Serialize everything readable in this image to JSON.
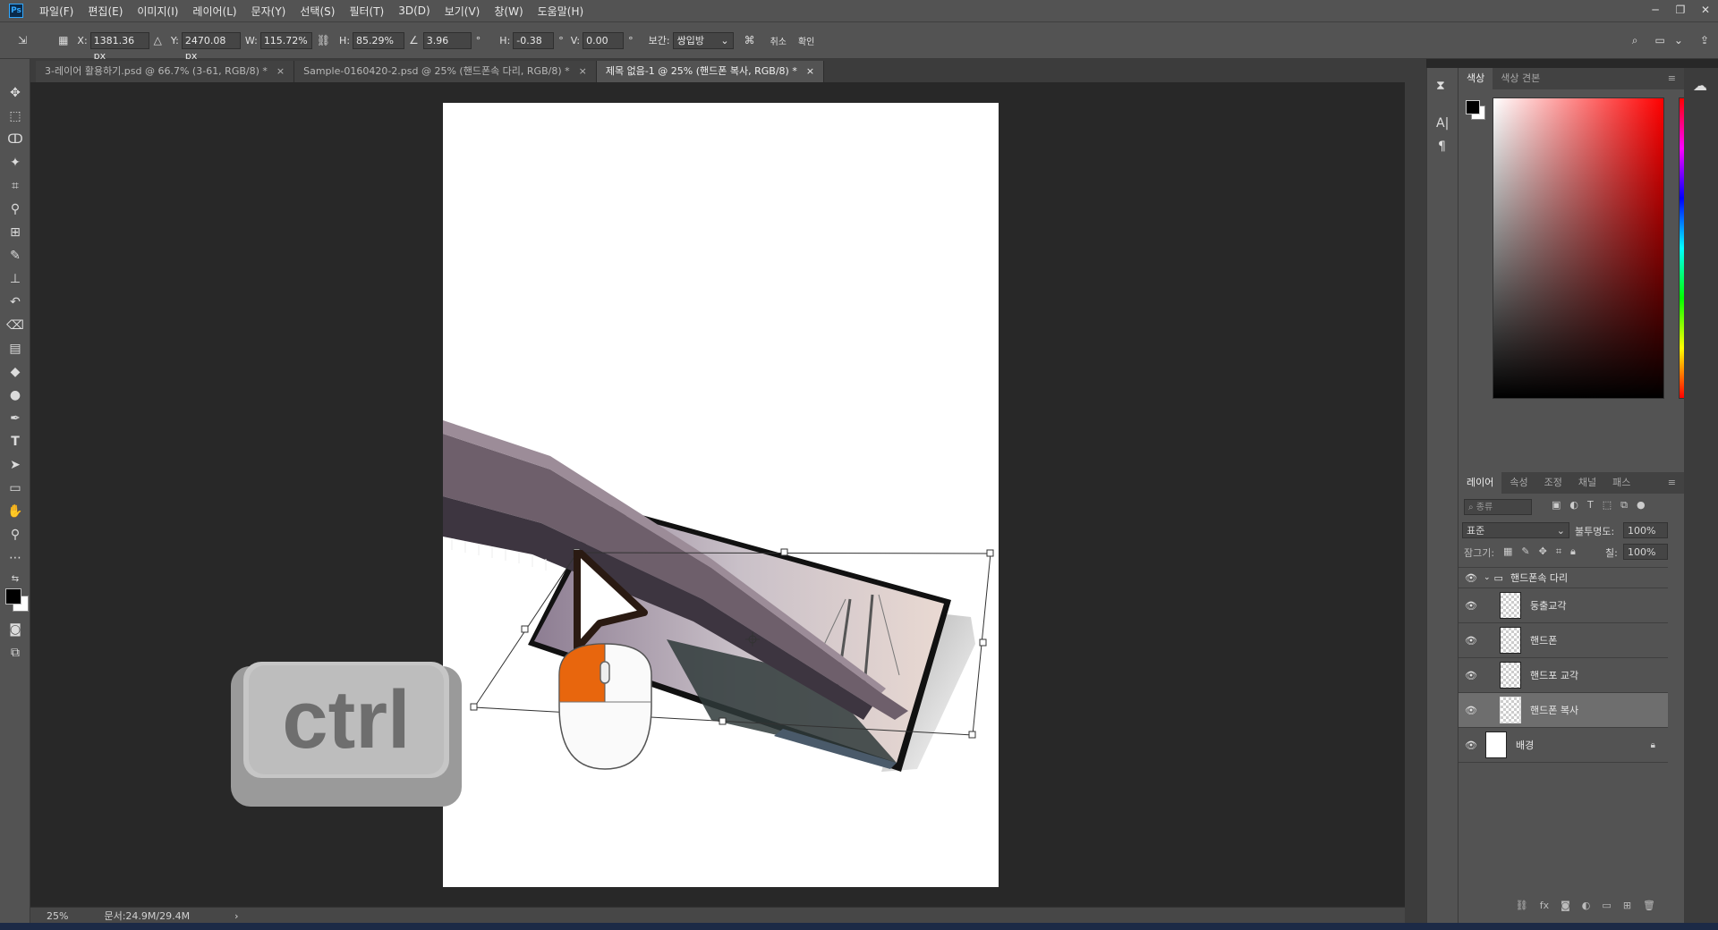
{
  "app": {
    "logo": "Ps"
  },
  "menubar": {
    "items": [
      "파일(F)",
      "편집(E)",
      "이미지(I)",
      "레이어(L)",
      "문자(Y)",
      "선택(S)",
      "필터(T)",
      "3D(D)",
      "보기(V)",
      "창(W)",
      "도움말(H)"
    ]
  },
  "options": {
    "x_label": "X:",
    "x_value": "1381.36 px",
    "y_label": "Y:",
    "y_value": "2470.08 px",
    "w_label": "W:",
    "w_value": "115.72%",
    "h_label": "H:",
    "h_value": "85.29%",
    "angle_value": "3.96",
    "deg": "°",
    "hskew_label": "H:",
    "hskew_value": "-0.38",
    "vskew_label": "V:",
    "vskew_value": "0.00",
    "interp_label": "보간:",
    "interp_value": "쌍입방",
    "cancel_label": "취소",
    "commit_label": "확인"
  },
  "tabs": [
    {
      "label": "3-레이어 활용하기.psd @ 66.7% (3-61, RGB/8) *",
      "close": "×"
    },
    {
      "label": "Sample-0160420-2.psd @ 25% (핸드폰속 다리, RGB/8) *",
      "close": "×"
    },
    {
      "label": "제목 없음-1 @ 25% (핸드폰 복사, RGB/8) *",
      "close": "×"
    }
  ],
  "overlay": {
    "ctrl_key": "ctrl"
  },
  "status": {
    "zoom": "25%",
    "doc": "문서:24.9M/29.4M",
    "arrow": "›"
  },
  "color_panel": {
    "tabs": [
      "색상",
      "색상 견본"
    ],
    "hue_top": "#ff0000",
    "foreground": "#000000",
    "background": "#ffffff"
  },
  "layers_panel": {
    "tabs": [
      "레이어",
      "속성",
      "조정",
      "채널",
      "패스"
    ],
    "filter_placeholder": "종류",
    "blend_mode": "표준",
    "opacity_label": "불투명도:",
    "opacity_value": "100%",
    "lock_label": "잠그기:",
    "fill_label": "칠:",
    "fill_value": "100%",
    "group": {
      "name": "핸드폰속 다리"
    },
    "layers": [
      {
        "name": "둥출교각"
      },
      {
        "name": "핸드폰"
      },
      {
        "name": "핸드포 교각"
      },
      {
        "name": "핸드폰 복사",
        "selected": true
      },
      {
        "name": "배경",
        "locked": true
      }
    ]
  }
}
